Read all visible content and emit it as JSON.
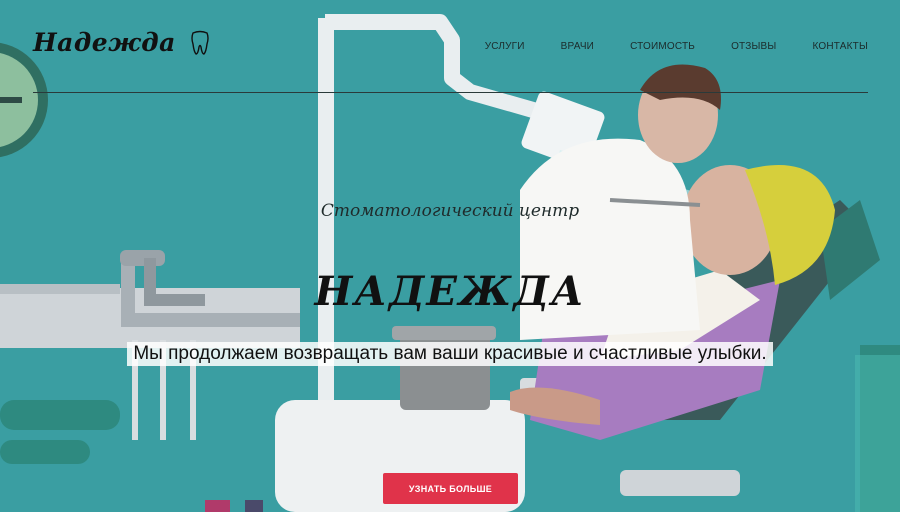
{
  "brand": {
    "name": "Надежда",
    "icon": "tooth-icon"
  },
  "nav": {
    "items": [
      {
        "label": "УСЛУГИ"
      },
      {
        "label": "ВРАЧИ"
      },
      {
        "label": "СТОИМОСТЬ"
      },
      {
        "label": "ОТЗЫВЫ"
      },
      {
        "label": "КОНТАКТЫ"
      }
    ]
  },
  "hero": {
    "subtitle": "Стоматологический центр",
    "title": "НАДЕЖДА",
    "tagline": "Мы продолжаем возвращать вам ваши красивые и счастливые улыбки.",
    "cta_label": "УЗНАТЬ БОЛЬШЕ"
  },
  "colors": {
    "background": "#3a9ea2",
    "accent": "#e0334a",
    "scrubs_purple": "#a77cc0",
    "cap_yellow": "#d6cf3c"
  }
}
